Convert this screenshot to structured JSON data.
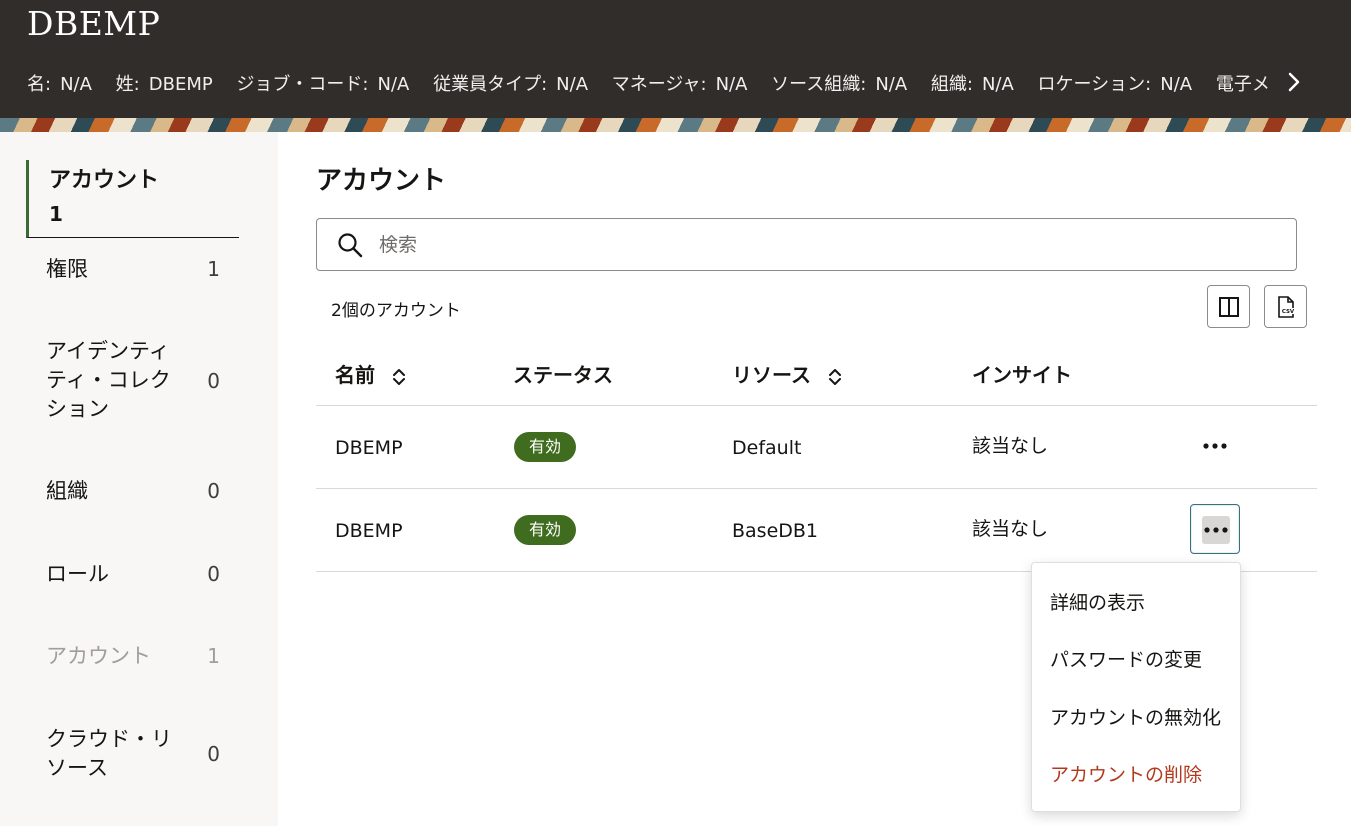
{
  "header": {
    "title": "DBEMP",
    "attributes": [
      {
        "label": "名:",
        "value": "N/A"
      },
      {
        "label": "姓:",
        "value": "DBEMP"
      },
      {
        "label": "ジョブ・コード:",
        "value": "N/A"
      },
      {
        "label": "従業員タイプ:",
        "value": "N/A"
      },
      {
        "label": "マネージャ:",
        "value": "N/A"
      },
      {
        "label": "ソース組織:",
        "value": "N/A"
      },
      {
        "label": "組織:",
        "value": "N/A"
      },
      {
        "label": "ロケーション:",
        "value": "N/A"
      },
      {
        "label": "電子メ",
        "value": ""
      }
    ]
  },
  "sidebar": {
    "active": {
      "label": "アカウント",
      "count": "1"
    },
    "items": [
      {
        "label": "権限",
        "count": "1"
      },
      {
        "label": "アイデンティティ・コレクション",
        "count": "0"
      },
      {
        "label": "組織",
        "count": "0"
      },
      {
        "label": "ロール",
        "count": "0"
      },
      {
        "label": "アカウント",
        "count": "1"
      },
      {
        "label": "クラウド・リソース",
        "count": "0"
      }
    ]
  },
  "main": {
    "title": "アカウント",
    "search_placeholder": "検索",
    "count_text": "2個のアカウント",
    "columns": [
      "名前",
      "ステータス",
      "リソース",
      "インサイト"
    ],
    "rows": [
      {
        "name": "DBEMP",
        "status": "有効",
        "resource": "Default",
        "insight": "該当なし"
      },
      {
        "name": "DBEMP",
        "status": "有効",
        "resource": "BaseDB1",
        "insight": "該当なし"
      }
    ]
  },
  "menu": {
    "items": [
      "詳細の表示",
      "パスワードの変更",
      "アカウントの無効化",
      "アカウントの削除"
    ]
  },
  "colors": {
    "header_bg": "#312d2a",
    "badge_green": "#3f6c1f",
    "danger_red": "#b3391d",
    "sidebar_accent": "#3a6b35"
  }
}
